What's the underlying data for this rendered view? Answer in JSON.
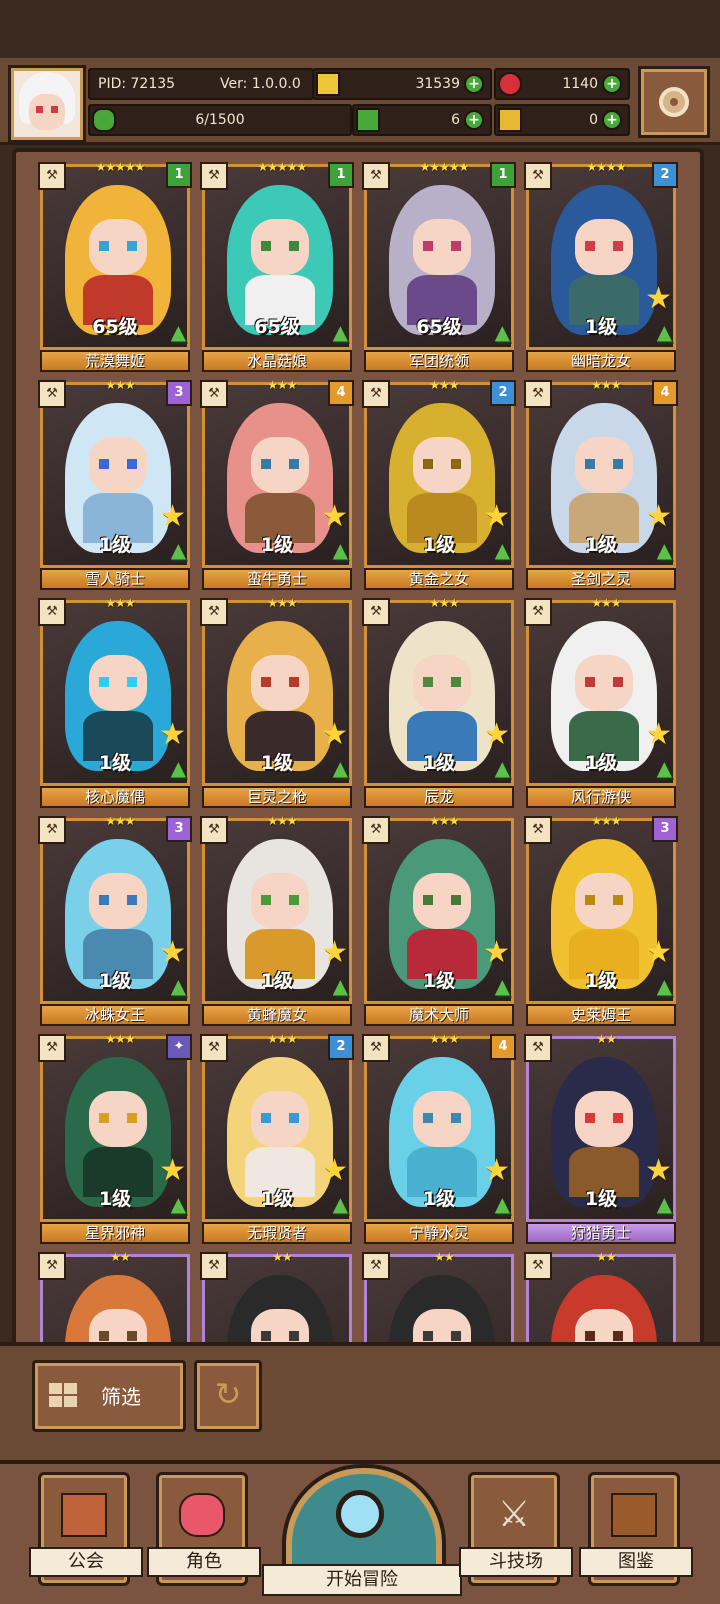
{
  "header": {
    "pid": "PID: 72135",
    "version": "Ver: 1.0.0.0",
    "gold": "31539",
    "gems": "1140",
    "exp": "6/1500",
    "clover": "6",
    "key": "0"
  },
  "colors": {
    "gold_frame": "#d49036",
    "purple_frame": "#b184d8",
    "badge_green": "#3ea23a",
    "badge_blue": "#3d8fd6",
    "badge_purple": "#9c62d6",
    "badge_orange": "#e39a2a"
  },
  "cards": [
    {
      "name": "荒漠舞姬",
      "level": "65级",
      "stars": "★★★★★",
      "badge": "1",
      "badge_color": "#3ea23a",
      "hair": "#f0b43a",
      "body": "#c0392b",
      "eye": "#3aa0d8",
      "frame": "gold",
      "show_star": false
    },
    {
      "name": "水晶菇娘",
      "level": "65级",
      "stars": "★★★★★",
      "badge": "1",
      "badge_color": "#3ea23a",
      "hair": "#3cc9b8",
      "body": "#f0f0f0",
      "eye": "#3a8a3a",
      "frame": "gold",
      "show_star": false
    },
    {
      "name": "军团统领",
      "level": "65级",
      "stars": "★★★★★",
      "badge": "1",
      "badge_color": "#3ea23a",
      "hair": "#b8b0c8",
      "body": "#6a4a8a",
      "eye": "#c03a6a",
      "frame": "gold",
      "show_star": false
    },
    {
      "name": "幽暗龙女",
      "level": "1级",
      "stars": "★★★★",
      "badge": "2",
      "badge_color": "#3d8fd6",
      "hair": "#2a5a9a",
      "body": "#3a6a6a",
      "eye": "#d23b4a",
      "frame": "gold",
      "show_star": true
    },
    {
      "name": "雪人骑士",
      "level": "1级",
      "stars": "★★★",
      "badge": "3",
      "badge_color": "#9c62d6",
      "hair": "#cfe6f4",
      "body": "#8ab4d8",
      "eye": "#3a6ad8",
      "frame": "gold",
      "show_star": true
    },
    {
      "name": "蛮牛勇士",
      "level": "1级",
      "stars": "★★★",
      "badge": "4",
      "badge_color": "#e39a2a",
      "hair": "#e8908a",
      "body": "#8a5a3a",
      "eye": "#3a7aa8",
      "frame": "gold",
      "show_star": true
    },
    {
      "name": "黄金之女",
      "level": "1级",
      "stars": "★★★",
      "badge": "2",
      "badge_color": "#3d8fd6",
      "hair": "#d8b030",
      "body": "#b88a20",
      "eye": "#8a6a10",
      "frame": "gold",
      "show_star": true
    },
    {
      "name": "圣剑之灵",
      "level": "1级",
      "stars": "★★★",
      "badge": "4",
      "badge_color": "#e39a2a",
      "hair": "#c8d8e8",
      "body": "#c8a878",
      "eye": "#3a7aa8",
      "frame": "gold",
      "show_star": true
    },
    {
      "name": "核心魔偶",
      "level": "1级",
      "stars": "★★★",
      "badge": "",
      "badge_color": "",
      "hair": "#2aa8d8",
      "body": "#1a4a5a",
      "eye": "#2ad0f0",
      "frame": "gold",
      "show_star": true
    },
    {
      "name": "巨灵之枪",
      "level": "1级",
      "stars": "★★★",
      "badge": "",
      "badge_color": "",
      "hair": "#e8b04a",
      "body": "#3a2a2a",
      "eye": "#b83a2a",
      "frame": "gold",
      "show_star": true
    },
    {
      "name": "辰龙",
      "level": "1级",
      "stars": "★★★",
      "badge": "",
      "badge_color": "",
      "hair": "#eee2c8",
      "body": "#3a7ab8",
      "eye": "#4a8a3a",
      "frame": "gold",
      "show_star": true
    },
    {
      "name": "风行游侠",
      "level": "1级",
      "stars": "★★★",
      "badge": "",
      "badge_color": "",
      "hair": "#f0f0f0",
      "body": "#3a6a4a",
      "eye": "#c03a3a",
      "frame": "gold",
      "show_star": true
    },
    {
      "name": "冰蛛女王",
      "level": "1级",
      "stars": "★★★",
      "badge": "3",
      "badge_color": "#9c62d6",
      "hair": "#7ad0e8",
      "body": "#4a8ab0",
      "eye": "#3a7ab8",
      "frame": "gold",
      "show_star": true
    },
    {
      "name": "黄蜂魔女",
      "level": "1级",
      "stars": "★★★",
      "badge": "",
      "badge_color": "",
      "hair": "#e8e4e0",
      "body": "#d89a2a",
      "eye": "#4a9a3a",
      "frame": "gold",
      "show_star": true
    },
    {
      "name": "魔术大师",
      "level": "1级",
      "stars": "★★★",
      "badge": "",
      "badge_color": "",
      "hair": "#4a9a7a",
      "body": "#b82a3a",
      "eye": "#4a7a3a",
      "frame": "gold",
      "show_star": true
    },
    {
      "name": "史莱姆王",
      "level": "1级",
      "stars": "★★★",
      "badge": "3",
      "badge_color": "#9c62d6",
      "hair": "#f0c030",
      "body": "#e8b020",
      "eye": "#b88a10",
      "frame": "gold",
      "show_star": true
    },
    {
      "name": "星界邪神",
      "level": "1级",
      "stars": "★★★",
      "badge": "✦",
      "badge_color": "#6a5ab8",
      "hair": "#2a6a4a",
      "body": "#1a3a2a",
      "eye": "#d8a020",
      "frame": "gold",
      "show_star": true
    },
    {
      "name": "无瑕贤者",
      "level": "1级",
      "stars": "★★★",
      "badge": "2",
      "badge_color": "#3d8fd6",
      "hair": "#f4d47a",
      "body": "#f0e8e0",
      "eye": "#3a9ad8",
      "frame": "gold",
      "show_star": true
    },
    {
      "name": "宁静水灵",
      "level": "1级",
      "stars": "★★★",
      "badge": "4",
      "badge_color": "#e39a2a",
      "hair": "#6ad0e8",
      "body": "#4ab0d0",
      "eye": "#3a8ab0",
      "frame": "gold",
      "show_star": true
    },
    {
      "name": "狩猎勇士",
      "level": "1级",
      "stars": "★★",
      "badge": "",
      "badge_color": "",
      "hair": "#2a2a4a",
      "body": "#8a5a2a",
      "eye": "#d83a3a",
      "frame": "purple",
      "show_star": true
    },
    {
      "name": "",
      "level": "",
      "stars": "★★",
      "badge": "",
      "badge_color": "",
      "hair": "#d8783a",
      "body": "#b85a2a",
      "eye": "#6a4a2a",
      "frame": "purple",
      "show_star": false
    },
    {
      "name": "",
      "level": "",
      "stars": "★★",
      "badge": "",
      "badge_color": "",
      "hair": "#2a2a2a",
      "body": "#f0f0f0",
      "eye": "#3a3a3a",
      "frame": "purple",
      "show_star": false
    },
    {
      "name": "",
      "level": "",
      "stars": "★★",
      "badge": "",
      "badge_color": "",
      "hair": "#2a2a2a",
      "body": "#e8e8e8",
      "eye": "#3a3a3a",
      "frame": "purple",
      "show_star": false
    },
    {
      "name": "",
      "level": "",
      "stars": "★★",
      "badge": "",
      "badge_color": "",
      "hair": "#c83a2a",
      "body": "#a82a1a",
      "eye": "#5a2a1a",
      "frame": "purple",
      "show_star": false
    }
  ],
  "controls": {
    "filter_label": "筛选"
  },
  "nav": {
    "guild": "公会",
    "characters": "角色",
    "adventure": "开始冒险",
    "arena": "斗技场",
    "codex": "图鉴"
  }
}
